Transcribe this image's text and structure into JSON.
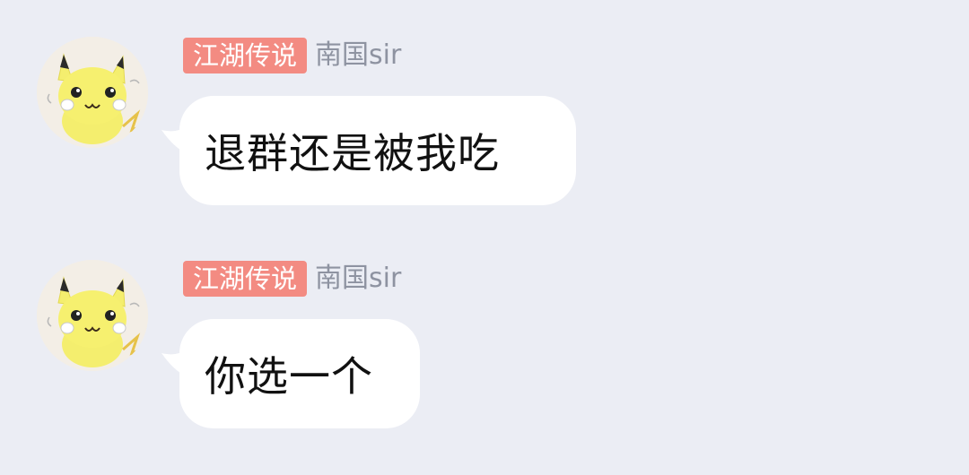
{
  "messages": [
    {
      "sender": {
        "title_badge": "江湖传说",
        "name": "南国sir"
      },
      "text": "退群还是被我吃"
    },
    {
      "sender": {
        "title_badge": "江湖传说",
        "name": "南国sir"
      },
      "text": "你选一个"
    }
  ],
  "colors": {
    "background": "#ebedf4",
    "bubble": "#ffffff",
    "title_badge": "#f38b82",
    "sender_name": "#8e93a1"
  },
  "icons": {
    "avatar": "pikachu-avatar-icon"
  }
}
